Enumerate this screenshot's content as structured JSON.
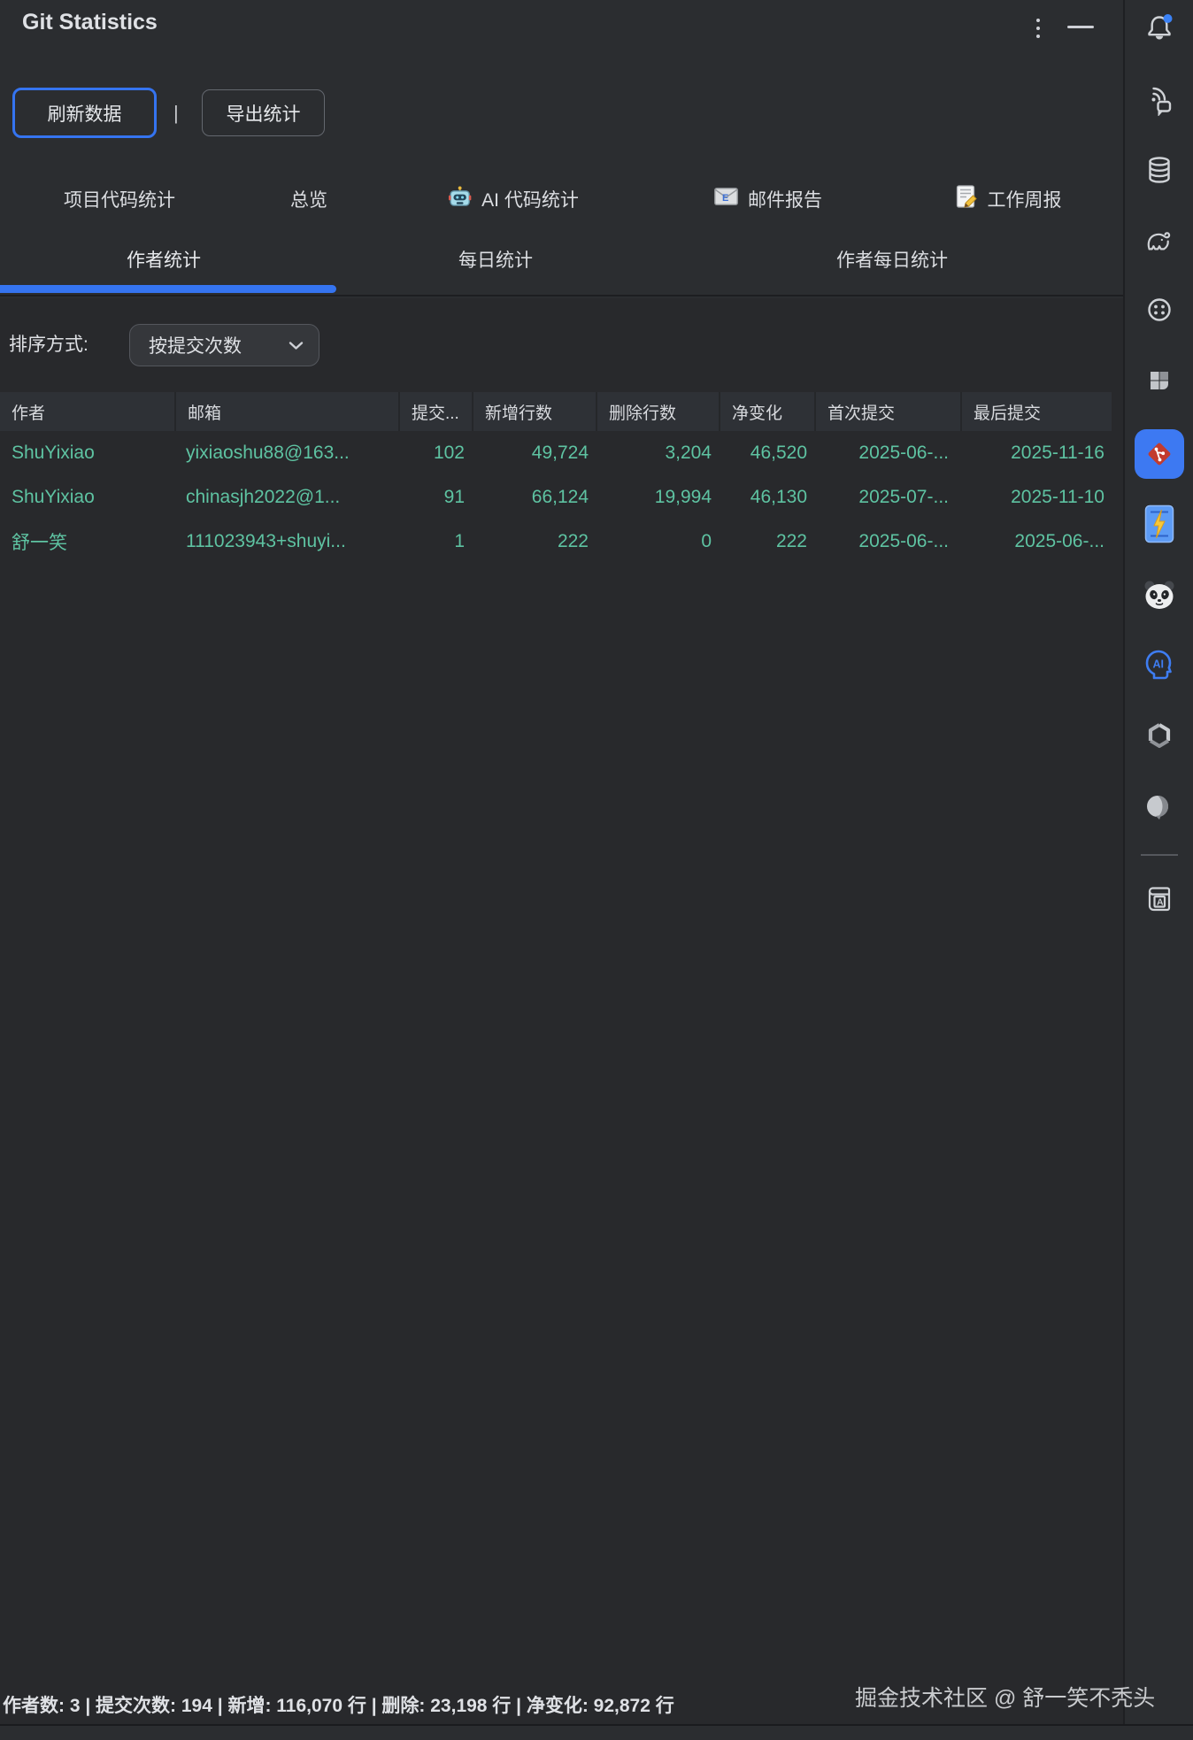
{
  "window": {
    "title": "Git Statistics",
    "controls": {
      "kebab_menu": "more-options",
      "minimize": "minimize"
    }
  },
  "toolbar": {
    "refresh_label": "刷新数据",
    "separator": "|",
    "export_label": "导出统计"
  },
  "tabs_primary": [
    {
      "label": "项目代码统计"
    },
    {
      "label": "总览"
    },
    {
      "label": "AI 代码统计",
      "icon": "robot-icon"
    },
    {
      "label": "邮件报告",
      "icon": "email-icon"
    },
    {
      "label": "工作周报",
      "icon": "memo-icon"
    }
  ],
  "tabs_secondary": [
    {
      "label": "作者统计",
      "active": true
    },
    {
      "label": "每日统计",
      "active": false
    },
    {
      "label": "作者每日统计",
      "active": false
    }
  ],
  "sort": {
    "label": "排序方式:",
    "value": "按提交次数"
  },
  "table": {
    "headers": [
      "作者",
      "邮箱",
      "提交...",
      "新增行数",
      "删除行数",
      "净变化",
      "首次提交",
      "最后提交"
    ],
    "rows": [
      [
        "ShuYixiao",
        "yixiaoshu88@163...",
        "102",
        "49,724",
        "3,204",
        "46,520",
        "2025-06-...",
        "2025-11-16"
      ],
      [
        "ShuYixiao",
        "chinasjh2022@1...",
        "91",
        "66,124",
        "19,994",
        "46,130",
        "2025-07-...",
        "2025-11-10"
      ],
      [
        "舒一笑",
        "111023943+shuyi...",
        "1",
        "222",
        "0",
        "222",
        "2025-06-...",
        "2025-06-..."
      ]
    ]
  },
  "status_bar": {
    "summary": "作者数: 3 | 提交次数: 194 | 新增: 116,070 行 | 删除: 23,198 行 | 净变化: 92,872 行"
  },
  "watermark": "掘金技术社区 @ 舒一笑不秃头",
  "sidebar": {
    "icons": [
      {
        "name": "notification-bell-icon",
        "badge": true
      },
      {
        "name": "screencast-chat-icon"
      },
      {
        "name": "database-icon"
      },
      {
        "name": "gradle-elephant-icon"
      },
      {
        "name": "circle-dots-icon"
      },
      {
        "name": "plugin-tiles-icon"
      },
      {
        "name": "git-statistics-icon",
        "active": true
      },
      {
        "name": "lightning-card-icon"
      },
      {
        "name": "panda-icon"
      },
      {
        "name": "ai-assistant-icon"
      },
      {
        "name": "knot-icon"
      },
      {
        "name": "cylinder-icon"
      },
      {
        "name": "dictionary-book-icon"
      }
    ]
  },
  "colors": {
    "accent": "#3574F0",
    "table_text": "#5EC3A2",
    "background": "#2B2D30",
    "git_icon_red": "#C23B2E"
  }
}
